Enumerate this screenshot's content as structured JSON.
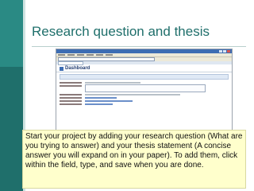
{
  "slide": {
    "title": "Research question and thesis",
    "caption": "Start your project by adding your research question (What are you trying to answer) and your thesis statement (A concise answer you will expand on in your paper). To add them, click within the field, type, and save when you are done."
  },
  "screenshot": {
    "app_title": "Dashboard"
  },
  "colors": {
    "accent": "#1f6f6b",
    "callout_bg": "#ffffcc",
    "browser_title": "#3d6db3"
  }
}
